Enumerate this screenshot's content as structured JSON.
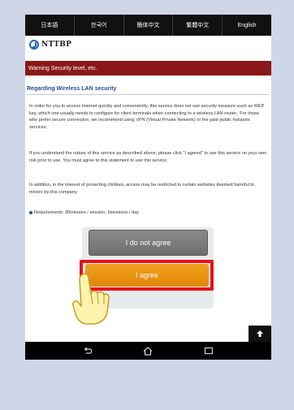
{
  "languages": [
    "日本語",
    "한국어",
    "簡体中文",
    "繁體中文",
    "English"
  ],
  "logo": {
    "text": "NTTBP"
  },
  "warning": {
    "text": "Warning Security level, etc."
  },
  "section": {
    "title": "Regarding Wireless LAN security"
  },
  "paragraphs": {
    "p1": "In order for you to access Internet quickly and conveniently, this service does not use security measure such as WEP key, which one usually needs to configure for client terminals when connecting to a wireless LAN router,. For those who prefer secure connection, we recommend using VPN (Virtual Private Network) or the paid public hotspots services.",
    "p2": "If you understand the nature of this service as described above, please click \"I agreed\" to use this service on your own risk prior to use. You must agree to this statement to use this service.",
    "p3": "In addition, in the interest of protecting children, access may be restricted to certain websites deemed harmful to minors by this company."
  },
  "requirements": {
    "text": "Requirements: 30minutes / session, 5sessions / day"
  },
  "buttons": {
    "disagree": "I do not agree",
    "agree": "I agree"
  },
  "colors": {
    "brand_blue": "#1d64b4",
    "warning_red": "#8b1818",
    "highlight_red": "#e8111a",
    "agree_orange": "#f09818"
  },
  "icons": {
    "logo": "nttbp-logo-icon",
    "pointer": "pointing-hand-icon",
    "scroll_top": "arrow-up-icon",
    "nav_back": "back-icon",
    "nav_home": "home-icon",
    "nav_recent": "recent-apps-icon"
  }
}
